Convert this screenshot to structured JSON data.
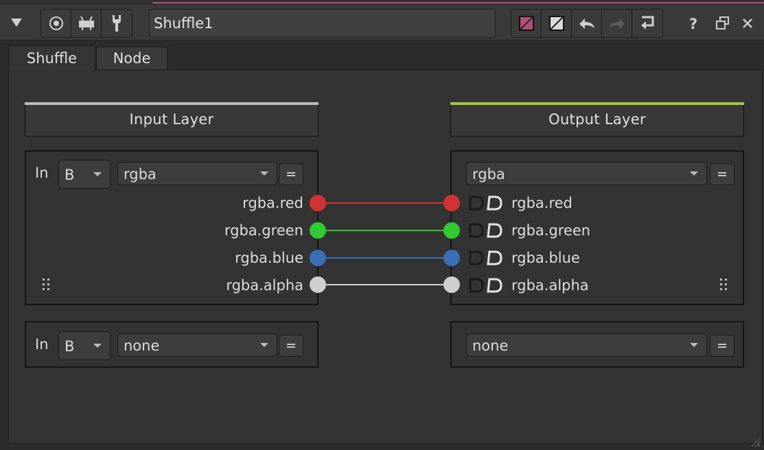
{
  "header": {
    "node_name": "Shuffle1",
    "icons": [
      "collapse-triangle-icon",
      "viewer-icon",
      "node-graph-icon",
      "wrench-icon",
      "node-color-icon",
      "undo-color-icon",
      "undo-icon",
      "redo-icon",
      "revert-icon",
      "help-icon",
      "float-window-icon",
      "close-icon"
    ],
    "accent_color": "#b34d7a"
  },
  "tabs": [
    {
      "label": "Shuffle",
      "active": true
    },
    {
      "label": "Node",
      "active": false
    }
  ],
  "input_layer": {
    "title": "Input Layer",
    "bar_color": "#bdbdbd",
    "rows": [
      {
        "in_label": "In",
        "source": "B",
        "layer": "rgba"
      },
      {
        "in_label": "In",
        "source": "B",
        "layer": "none"
      }
    ],
    "channels": [
      "rgba.red",
      "rgba.green",
      "rgba.blue",
      "rgba.alpha"
    ]
  },
  "output_layer": {
    "title": "Output Layer",
    "bar_color": "#a7c73a",
    "rows": [
      {
        "layer": "rgba"
      },
      {
        "layer": "none"
      }
    ],
    "channels": [
      "rgba.red",
      "rgba.green",
      "rgba.blue",
      "rgba.alpha"
    ]
  },
  "channel_colors": [
    "#d13333",
    "#33c933",
    "#3a6fb5",
    "#cfcfcf"
  ]
}
